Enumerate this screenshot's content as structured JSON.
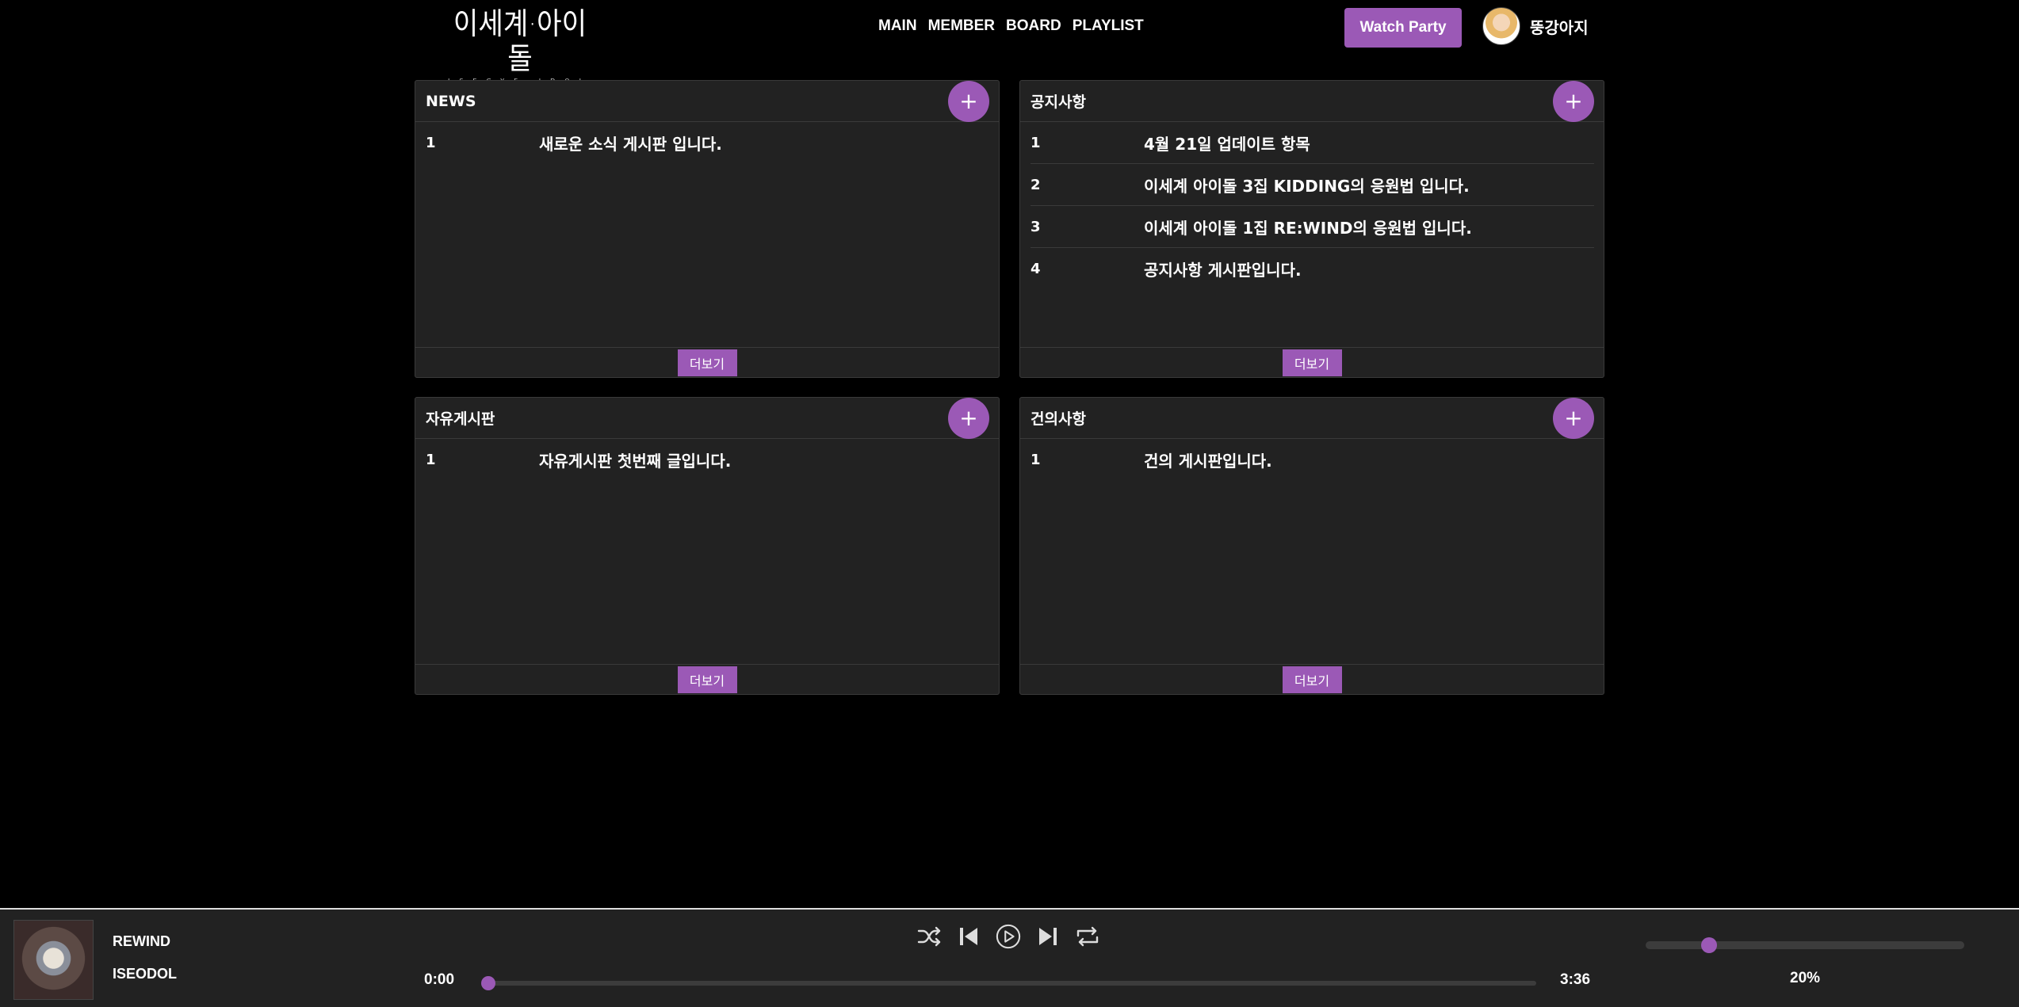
{
  "logo": {
    "main": "이세계·아이돌",
    "sub": "ISEGYE IDOL"
  },
  "nav": [
    "MAIN",
    "MEMBER",
    "BOARD",
    "PLAYLIST"
  ],
  "watch_party": "Watch Party",
  "user": {
    "name": "뚱강아지"
  },
  "boards": [
    {
      "title": "NEWS",
      "add": "+",
      "more": "더보기",
      "rows": [
        {
          "num": "1",
          "title": "새로운 소식 게시판 입니다."
        }
      ]
    },
    {
      "title": "공지사항",
      "add": "+",
      "more": "더보기",
      "rows": [
        {
          "num": "1",
          "title": "4월 21일 업데이트 항목"
        },
        {
          "num": "2",
          "title": "이세계 아이돌 3집 KIDDING의 응원법 입니다."
        },
        {
          "num": "3",
          "title": "이세계 아이돌 1집 RE:WIND의 응원법 입니다."
        },
        {
          "num": "4",
          "title": "공지사항 게시판입니다."
        }
      ]
    },
    {
      "title": "자유게시판",
      "add": "+",
      "more": "더보기",
      "rows": [
        {
          "num": "1",
          "title": "자유게시판 첫번째 글입니다."
        }
      ]
    },
    {
      "title": "건의사항",
      "add": "+",
      "more": "더보기",
      "rows": [
        {
          "num": "1",
          "title": "건의 게시판입니다."
        }
      ]
    }
  ],
  "player": {
    "title": "REWIND",
    "artist": "ISEODOL",
    "current_time": "0:00",
    "duration": "3:36",
    "progress": 0.0,
    "volume": 0.2,
    "volume_label": "20%",
    "icons": [
      "shuffle-icon",
      "previous-icon",
      "play-icon",
      "next-icon",
      "repeat-icon"
    ]
  },
  "colors": {
    "accent": "#9b59b6",
    "panel": "#222222",
    "background": "#000000"
  }
}
